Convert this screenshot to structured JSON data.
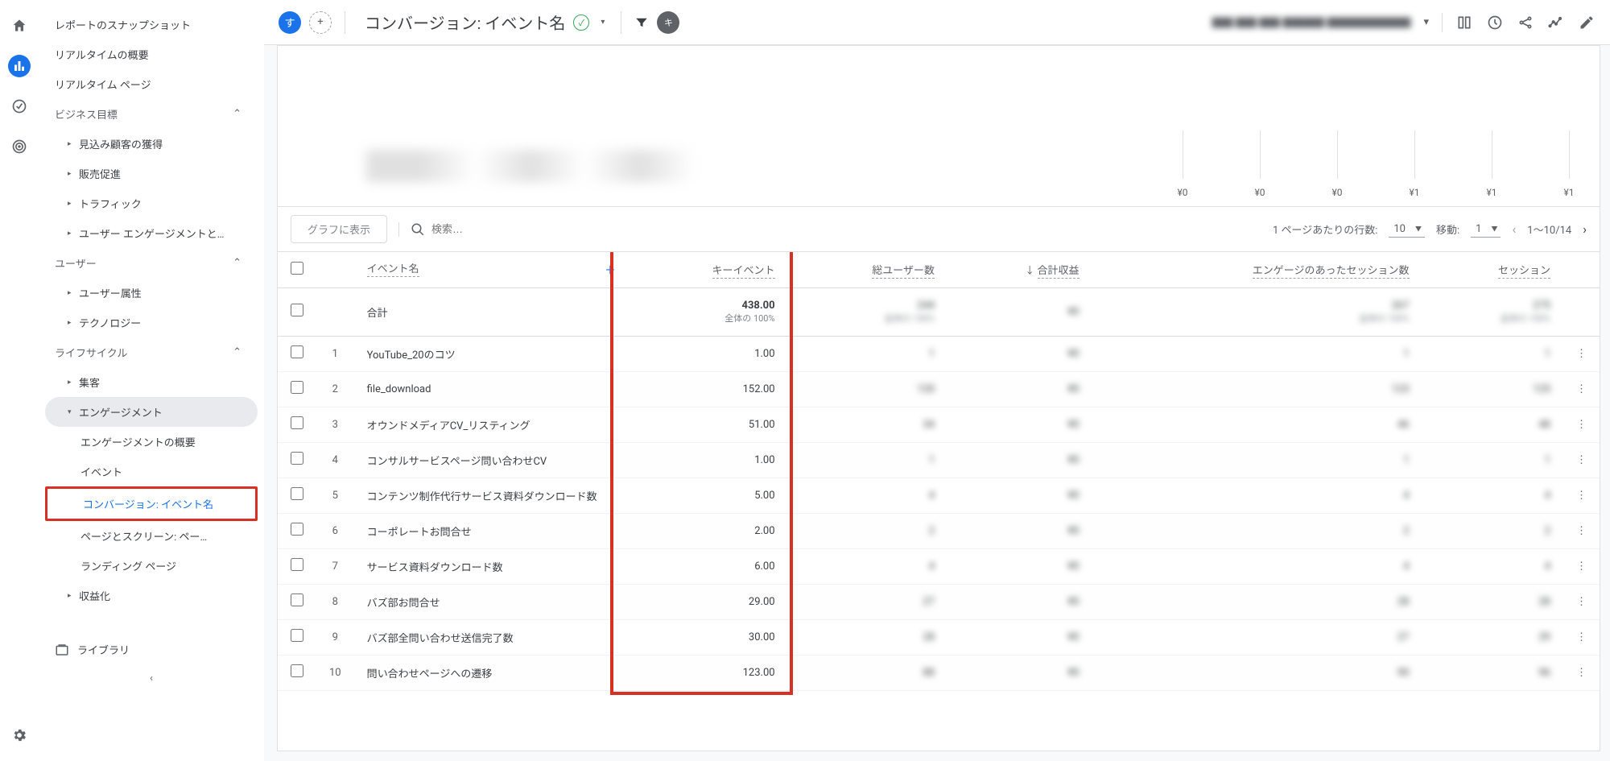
{
  "rail": {
    "icons": [
      "home",
      "reports",
      "ads",
      "explore",
      "settings"
    ]
  },
  "sidebar": {
    "items": [
      {
        "label": "レポートのスナップショット"
      },
      {
        "label": "リアルタイムの概要"
      },
      {
        "label": "リアルタイム ページ"
      }
    ],
    "group_biz": "ビジネス目標",
    "biz_items": [
      "見込み顧客の獲得",
      "販売促進",
      "トラフィック",
      "ユーザー エンゲージメントと…"
    ],
    "group_user": "ユーザー",
    "user_items": [
      "ユーザー属性",
      "テクノロジー"
    ],
    "group_life": "ライフサイクル",
    "life_items": [
      "集客"
    ],
    "engagement": "エンゲージメント",
    "eng_items": [
      "エンゲージメントの概要",
      "イベント",
      "コンバージョン: イベント名",
      "ページとスクリーン: ペー…",
      "ランディング ページ"
    ],
    "monetize": "収益化",
    "library": "ライブラリ"
  },
  "topbar": {
    "chip1": "す",
    "title": "コンバージョン: イベント名",
    "filter_chip": "キ",
    "blur": "██ ██ ██   ████   ████████",
    "caret": "▾"
  },
  "ticks": [
    "¥0",
    "¥0",
    "¥0",
    "¥1",
    "¥1",
    "¥1"
  ],
  "controls": {
    "graph_btn": "グラフに表示",
    "search_placeholder": "検索…",
    "rows_label": "1 ページあたりの行数:",
    "rows_value": "10",
    "goto_label": "移動:",
    "goto_value": "1",
    "range": "1～10/14"
  },
  "headers": {
    "event_name": "イベント名",
    "key_event": "キーイベント",
    "total_users": "総ユーザー数",
    "total_rev": "合計収益",
    "engaged_sessions": "エンゲージのあったセッション数",
    "sessions": "セッション"
  },
  "totals": {
    "label": "合計",
    "key_event": "438.00",
    "key_event_sub": "全体の 100%",
    "users": "244",
    "users_sub": "全体の 100%",
    "rev": "¥0",
    "eng": "267",
    "eng_sub": "全体の 100%",
    "sess": "275",
    "sess_sub": "全体の 100%"
  },
  "rows": [
    {
      "name": "YouTube_20のコツ",
      "key": "1.00",
      "users": "1",
      "rev": "¥0",
      "eng": "1",
      "sess": "1"
    },
    {
      "name": "file_download",
      "key": "152.00",
      "users": "120",
      "rev": "¥0",
      "eng": "123",
      "sess": "125"
    },
    {
      "name": "オウンドメディアCV_リスティング",
      "key": "51.00",
      "users": "34",
      "rev": "¥0",
      "eng": "46",
      "sess": "48"
    },
    {
      "name": "コンサルサービスページ問い合わせCV",
      "key": "1.00",
      "users": "1",
      "rev": "¥0",
      "eng": "1",
      "sess": "1"
    },
    {
      "name": "コンテンツ制作代行サービス資料ダウンロード数",
      "key": "5.00",
      "users": "4",
      "rev": "¥0",
      "eng": "4",
      "sess": "4"
    },
    {
      "name": "コーポレートお問合せ",
      "key": "2.00",
      "users": "2",
      "rev": "¥0",
      "eng": "2",
      "sess": "2"
    },
    {
      "name": "サービス資料ダウンロード数",
      "key": "6.00",
      "users": "4",
      "rev": "¥0",
      "eng": "4",
      "sess": "4"
    },
    {
      "name": "バズ部お問合せ",
      "key": "29.00",
      "users": "27",
      "rev": "¥0",
      "eng": "28",
      "sess": "28"
    },
    {
      "name": "バズ部全問い合わせ送信完了数",
      "key": "30.00",
      "users": "28",
      "rev": "¥0",
      "eng": "27",
      "sess": "29"
    },
    {
      "name": "問い合わせページへの遷移",
      "key": "123.00",
      "users": "88",
      "rev": "¥0",
      "eng": "90",
      "sess": "96"
    }
  ]
}
